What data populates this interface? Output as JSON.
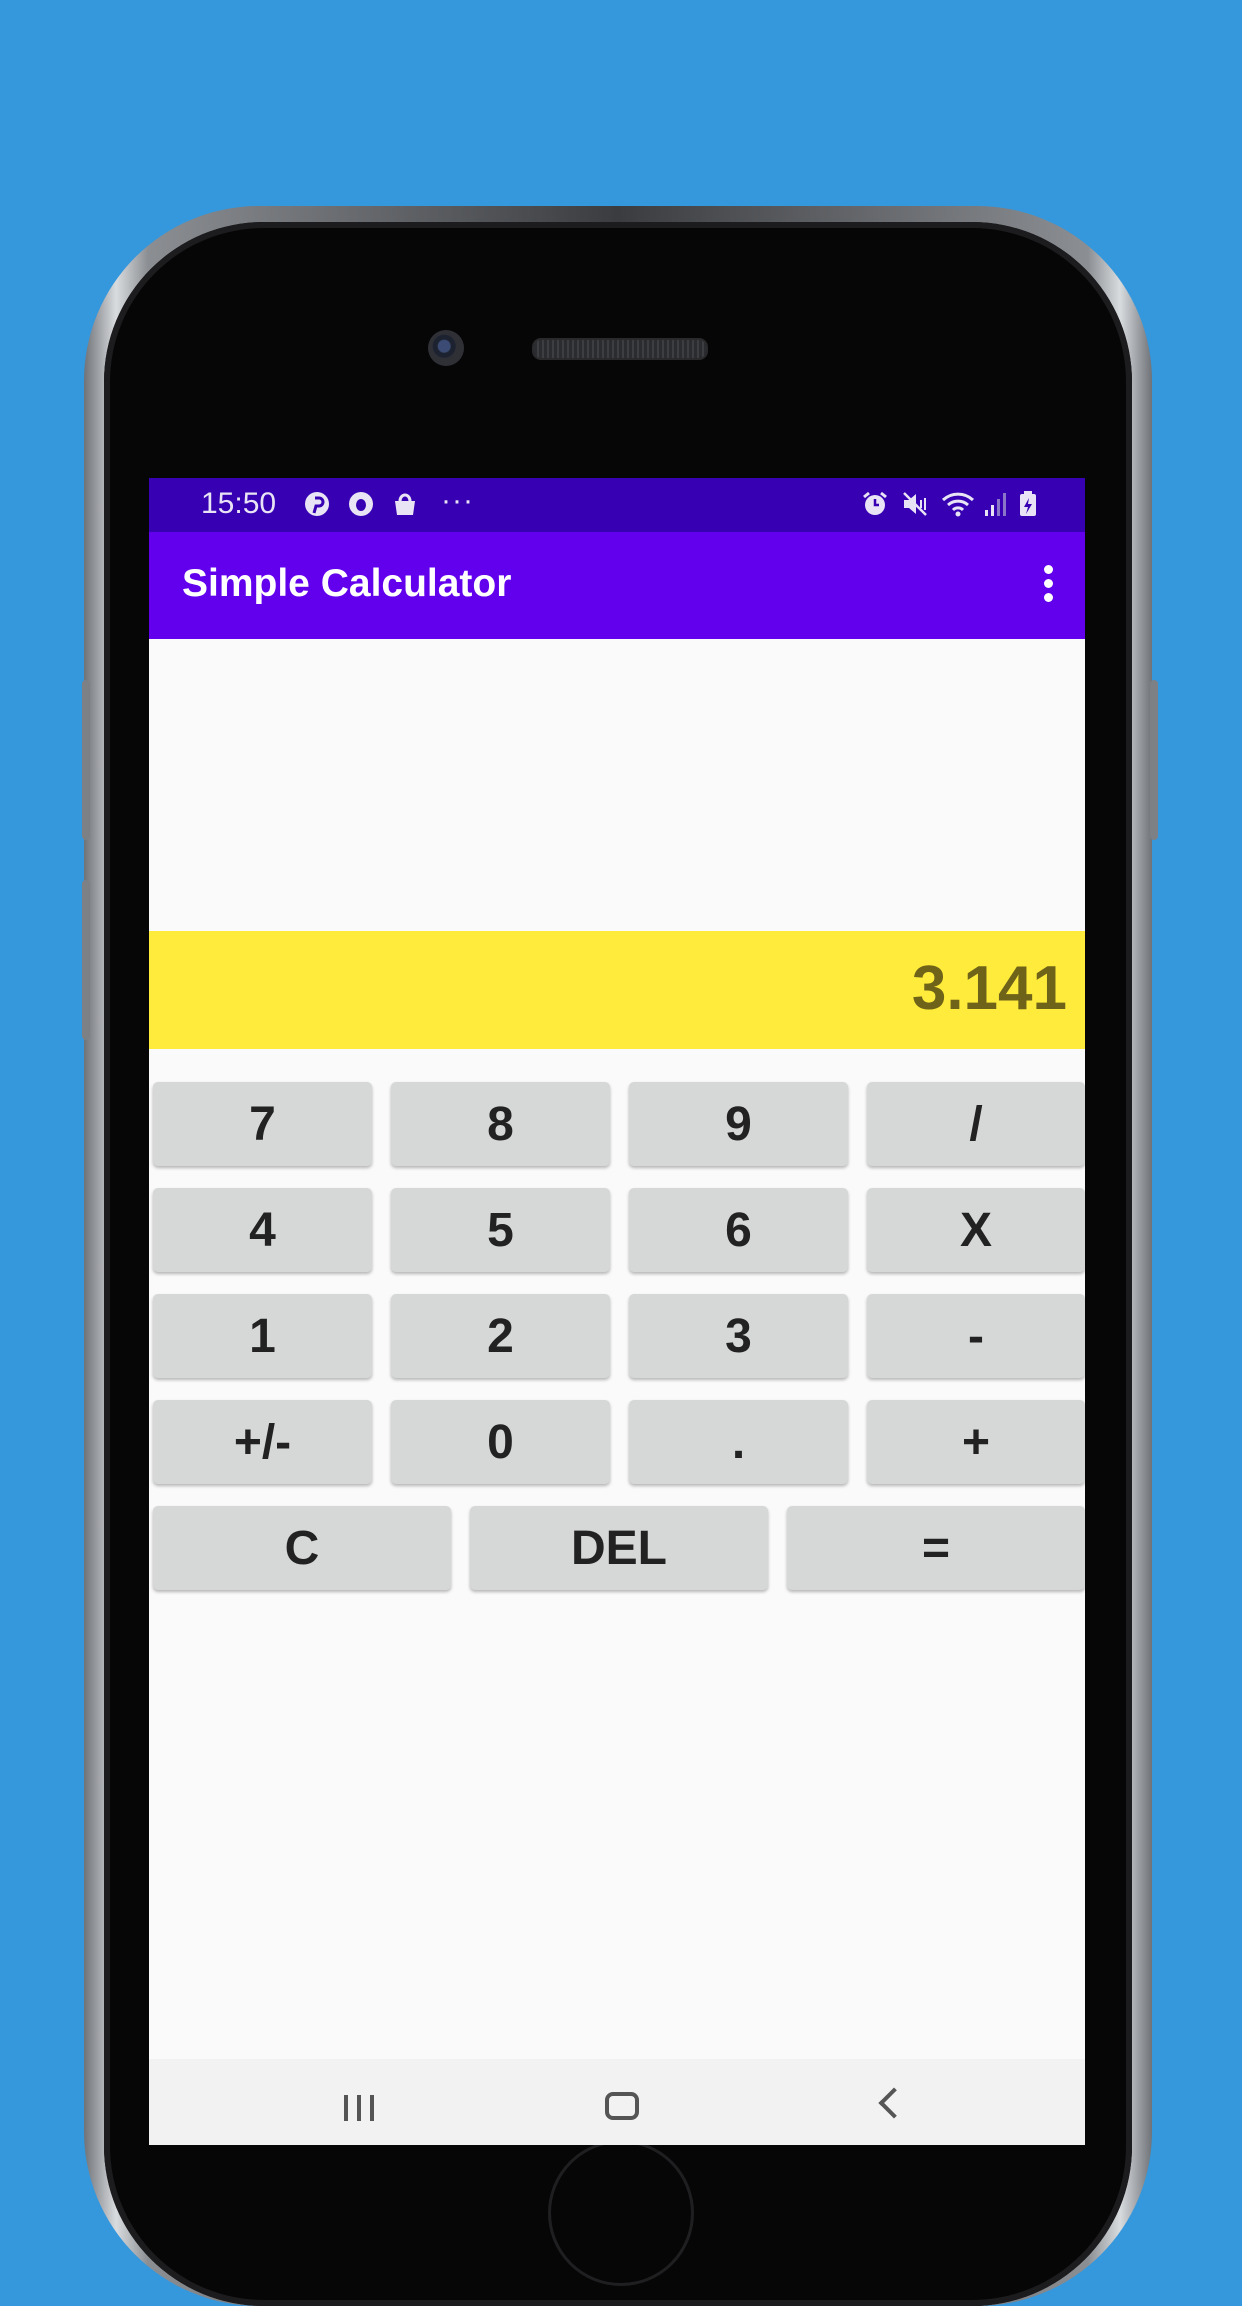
{
  "status_bar": {
    "time": "15:50",
    "left_icons": [
      "pinterest-icon",
      "opera-icon",
      "shopping-bag-icon",
      "more-notifications-icon"
    ],
    "more_text": "···",
    "right_icons": [
      "alarm-icon",
      "mute-icon",
      "wifi-icon",
      "signal-icon",
      "battery-charging-icon"
    ]
  },
  "app_bar": {
    "title": "Simple Calculator",
    "menu_icon": "more-vert-icon"
  },
  "display": {
    "result": "3.141",
    "expression": ""
  },
  "keypad": {
    "row1": [
      "7",
      "8",
      "9",
      "/"
    ],
    "row2": [
      "4",
      "5",
      "6",
      "X"
    ],
    "row3": [
      "1",
      "2",
      "3",
      "-"
    ],
    "row4": [
      "+/-",
      "0",
      ".",
      "+"
    ],
    "row5": [
      "C",
      "DEL",
      "="
    ]
  },
  "nav_bar": {
    "icons": [
      "recents-icon",
      "home-icon",
      "back-icon"
    ]
  },
  "colors": {
    "background": "#3597dc",
    "status_bar": "#3700b3",
    "app_bar": "#6200ee",
    "result_bg": "#ffeb3b",
    "result_text": "#6e6318",
    "key_bg": "#d6d7d7"
  }
}
